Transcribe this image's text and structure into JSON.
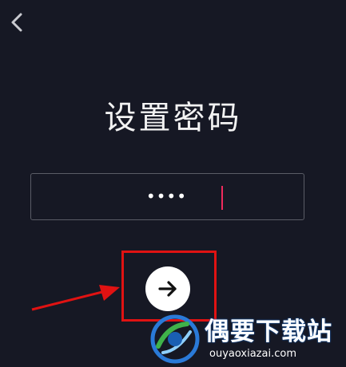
{
  "header": {
    "back_icon": "chevron-left-icon"
  },
  "title": "设置密码",
  "password_field": {
    "masked_value": "••••"
  },
  "next_button": {
    "icon": "arrow-right-icon"
  },
  "watermark": {
    "name": "偶要下载站",
    "url": "ouyaoxiazai.com"
  },
  "colors": {
    "background": "#161824",
    "caret": "#f02a5c",
    "annotation": "#e01212"
  }
}
